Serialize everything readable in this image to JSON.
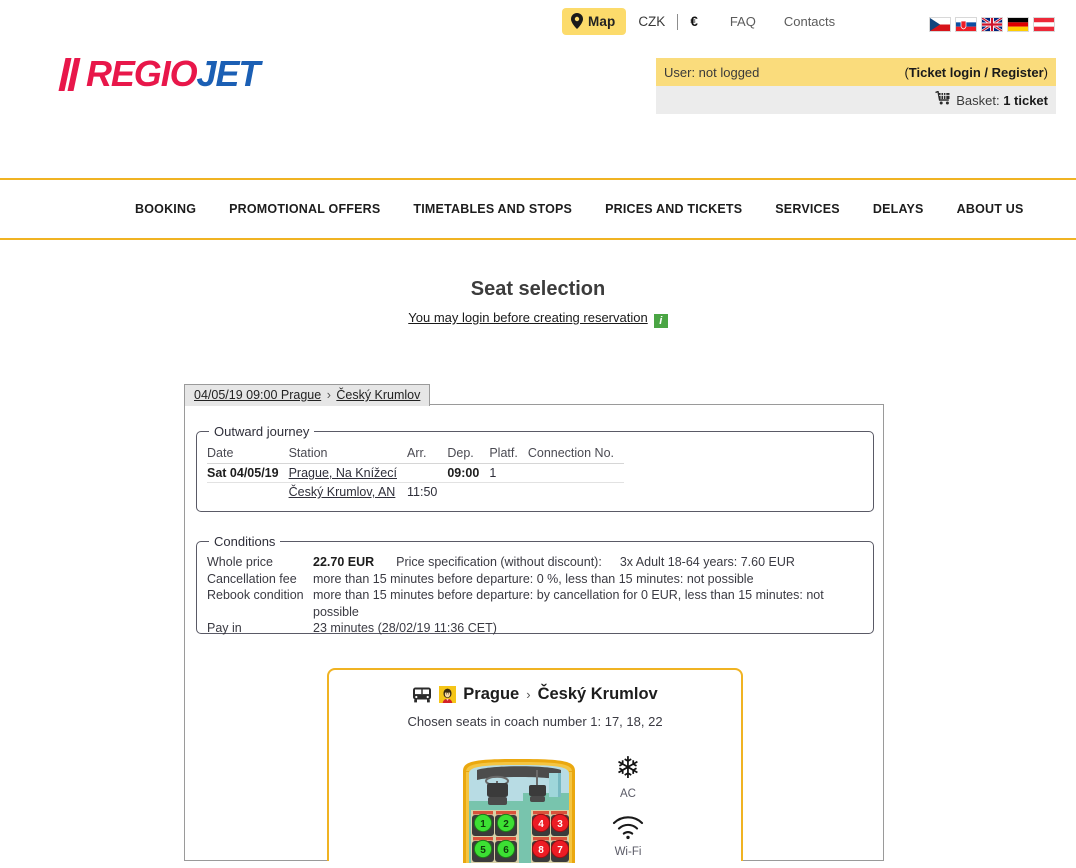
{
  "topbar": {
    "map_label": "Map",
    "map_icon": "location-pin-icon",
    "currency_czk": "CZK",
    "currency_eur": "€",
    "faq": "FAQ",
    "contacts": "Contacts",
    "flags": [
      {
        "name": "flag-cz",
        "title": "Czech"
      },
      {
        "name": "flag-sk",
        "title": "Slovak"
      },
      {
        "name": "flag-gb",
        "title": "English"
      },
      {
        "name": "flag-de",
        "title": "German"
      },
      {
        "name": "flag-at",
        "title": "Austrian"
      }
    ]
  },
  "logo": {
    "part1": "REGIO",
    "part2": "JET",
    "bars_icon": "slanted-bars-icon"
  },
  "account": {
    "user_label": "User: not logged",
    "login_open": "(",
    "login_link": "Ticket login / Register",
    "login_close": ")",
    "basket_icon": "shopping-cart-icon",
    "basket_label": "Basket:",
    "basket_value": "1 ticket"
  },
  "nav": {
    "items": [
      {
        "label": "BOOKING"
      },
      {
        "label": "PROMOTIONAL OFFERS"
      },
      {
        "label": "TIMETABLES AND STOPS"
      },
      {
        "label": "PRICES AND TICKETS"
      },
      {
        "label": "SERVICES"
      },
      {
        "label": "DELAYS"
      },
      {
        "label": "ABOUT US"
      }
    ]
  },
  "page": {
    "title": "Seat selection",
    "login_hint": "You may login before creating reservation",
    "info_badge": "i"
  },
  "tab": {
    "datetime": "04/05/19 09:00 Prague",
    "arrow": "›",
    "destination": "Český Krumlov"
  },
  "outward": {
    "legend": "Outward journey",
    "columns": [
      "Date",
      "Station",
      "Arr.",
      "Dep.",
      "Platf.",
      "Connection No."
    ],
    "rows": [
      {
        "date": "Sat 04/05/19",
        "station": "Prague, Na Knížecí",
        "arr": "",
        "dep": "09:00",
        "platf": "1",
        "conn": ""
      },
      {
        "date": "",
        "station": "Český Krumlov, AN",
        "arr": "11:50",
        "dep": "",
        "platf": "",
        "conn": ""
      }
    ]
  },
  "conditions": {
    "legend": "Conditions",
    "whole_price_label": "Whole price",
    "whole_price_value": "22.70 EUR",
    "price_spec_label": "Price specification (without discount):",
    "price_spec_value": "3x Adult 18-64 years: 7.60 EUR",
    "cancellation_label": "Cancellation fee",
    "cancellation_value": "more than 15 minutes before departure: 0 %, less than 15 minutes: not possible",
    "rebook_label": "Rebook condition",
    "rebook_value": "more than 15 minutes before departure: by cancellation for 0 EUR, less than 15 minutes: not possible",
    "payin_label": "Pay in",
    "payin_value": "23 minutes (28/02/19 11:36 CET)"
  },
  "seatcard": {
    "bus_icon": "bus-icon",
    "steward_icon": "steward-icon",
    "origin": "Prague",
    "arrow": "›",
    "destination": "Český Krumlov",
    "chosen_seats": "Chosen seats in coach number 1: 17, 18, 22",
    "amenities": [
      {
        "icon": "snowflake-icon",
        "caption": "AC"
      },
      {
        "icon": "wifi-icon",
        "caption": "Wi-Fi"
      }
    ],
    "seat_map": {
      "free_color": "#3ce033",
      "taken_color": "#ec1c24",
      "visible_seats": [
        {
          "number": "1",
          "state": "free"
        },
        {
          "number": "2",
          "state": "free"
        },
        {
          "number": "4",
          "state": "taken"
        },
        {
          "number": "3",
          "state": "taken"
        },
        {
          "number": "5",
          "state": "free"
        },
        {
          "number": "6",
          "state": "free"
        },
        {
          "number": "8",
          "state": "taken"
        },
        {
          "number": "7",
          "state": "taken"
        }
      ]
    }
  },
  "colors": {
    "brand_yellow": "#f0b323",
    "brand_red": "#e8174a",
    "brand_blue": "#1b5fb4",
    "header_yellow": "#fadc7c",
    "info_green": "#4aa544"
  }
}
